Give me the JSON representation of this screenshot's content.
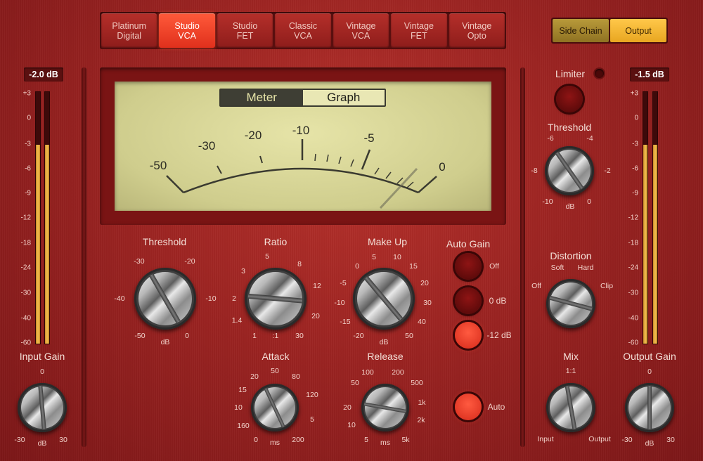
{
  "models": [
    {
      "line1": "Platinum",
      "line2": "Digital",
      "active": false
    },
    {
      "line1": "Studio",
      "line2": "VCA",
      "active": true
    },
    {
      "line1": "Studio",
      "line2": "FET",
      "active": false
    },
    {
      "line1": "Classic",
      "line2": "VCA",
      "active": false
    },
    {
      "line1": "Vintage",
      "line2": "VCA",
      "active": false
    },
    {
      "line1": "Vintage",
      "line2": "FET",
      "active": false
    },
    {
      "line1": "Vintage",
      "line2": "Opto",
      "active": false
    }
  ],
  "routing": {
    "side_chain": "Side Chain",
    "output": "Output"
  },
  "input_meter": {
    "readout": "-2.0 dB",
    "level": 0.79
  },
  "output_meter": {
    "readout": "-1.5 dB",
    "level": 0.79
  },
  "meter_scale": [
    "+3",
    "0",
    "-3",
    "-6",
    "-9",
    "-12",
    "-18",
    "-24",
    "-30",
    "-40",
    "-60"
  ],
  "display": {
    "view_meter": "Meter",
    "view_graph": "Graph",
    "scale": [
      "-50",
      "-30",
      "-20",
      "-10",
      "-5",
      "0"
    ]
  },
  "threshold": {
    "label": "Threshold",
    "ticks": [
      "-30",
      "-20",
      "-40",
      "-10",
      "-50",
      "dB",
      "0"
    ]
  },
  "ratio": {
    "label": "Ratio",
    "ticks": [
      "5",
      "3",
      "8",
      "2",
      "12",
      "1.4",
      "20",
      "1",
      ":1",
      "30"
    ]
  },
  "makeup": {
    "label": "Make Up",
    "ticks": [
      "5",
      "10",
      "0",
      "15",
      "-5",
      "20",
      "-10",
      "30",
      "-15",
      "40",
      "-20",
      "dB",
      "50"
    ]
  },
  "auto_gain": {
    "label": "Auto Gain",
    "off": "Off",
    "zero": "0 dB",
    "minus12": "-12 dB"
  },
  "attack": {
    "label": "Attack",
    "ticks": [
      "50",
      "20",
      "80",
      "15",
      "120",
      "10",
      "160",
      "5",
      "0",
      "ms",
      "200"
    ]
  },
  "release": {
    "label": "Release",
    "ticks": [
      "100",
      "200",
      "50",
      "500",
      "20",
      "1k",
      "10",
      "2k",
      "5",
      "ms",
      "5k"
    ]
  },
  "auto": {
    "label": "Auto"
  },
  "limiter": {
    "label": "Limiter"
  },
  "limiter_threshold": {
    "label": "Threshold",
    "ticks": [
      "-6",
      "-4",
      "-8",
      "-2",
      "-10",
      "dB",
      "0"
    ]
  },
  "distortion": {
    "label": "Distortion",
    "ticks": [
      "Soft",
      "Hard",
      "Off",
      "Clip"
    ]
  },
  "mix": {
    "label": "Mix",
    "ticks": [
      "1:1",
      "Input",
      "Output"
    ]
  },
  "input_gain": {
    "label": "Input Gain",
    "ticks": [
      "0",
      "-30",
      "dB",
      "30"
    ]
  },
  "output_gain": {
    "label": "Output Gain",
    "ticks": [
      "0",
      "-30",
      "dB",
      "30"
    ]
  }
}
